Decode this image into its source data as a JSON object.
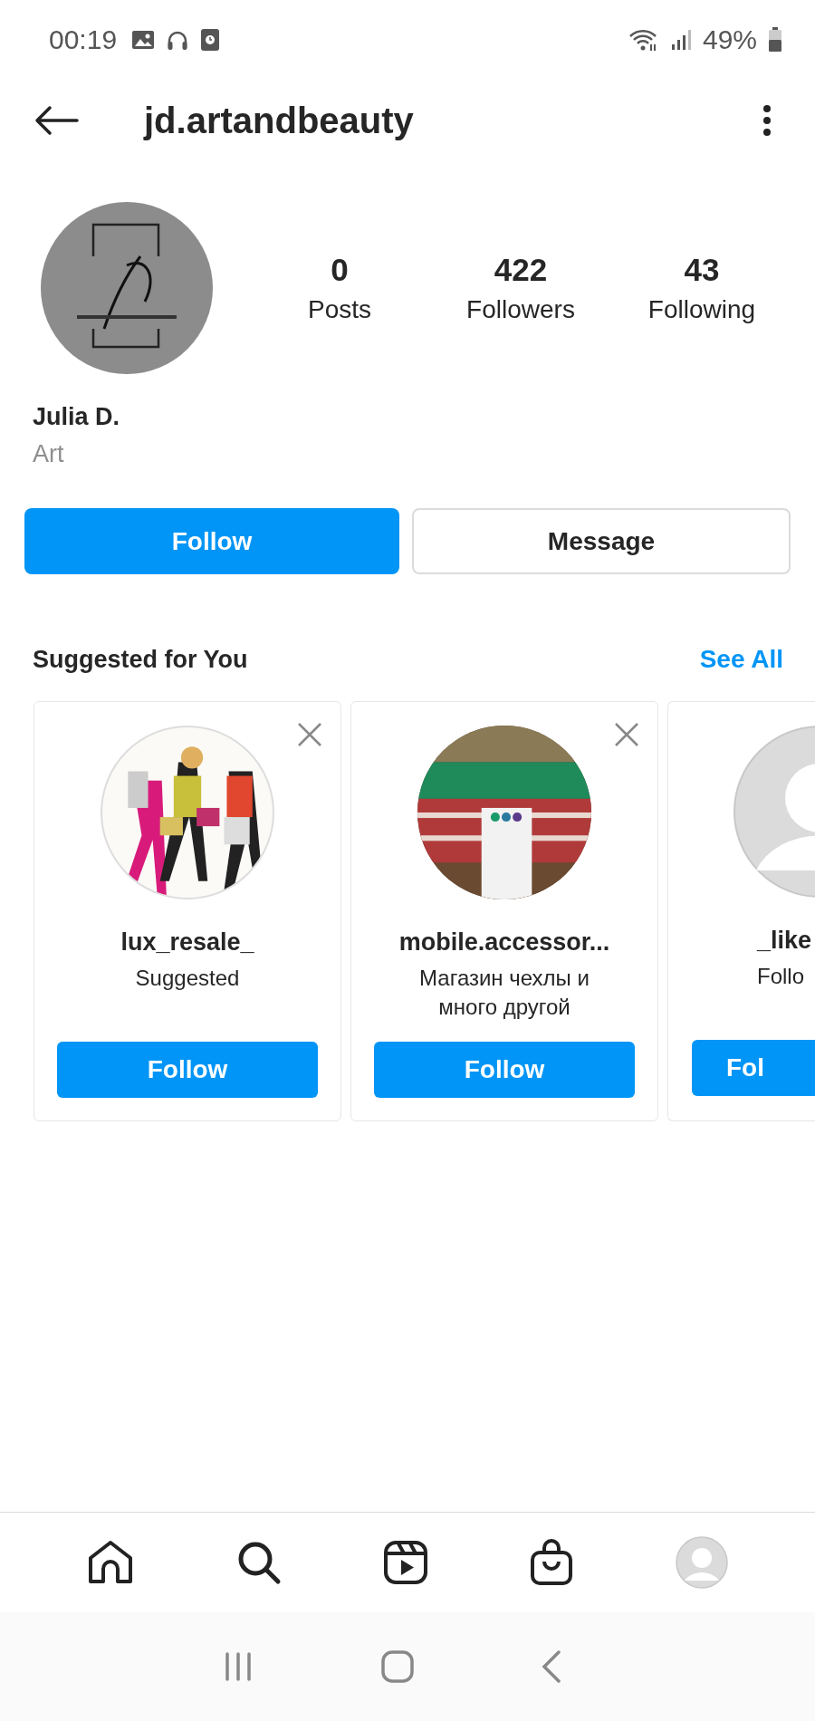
{
  "status_bar": {
    "time": "00:19",
    "battery": "49%"
  },
  "header": {
    "username": "jd.artandbeauty"
  },
  "profile": {
    "stats": [
      {
        "value": "0",
        "label": "Posts"
      },
      {
        "value": "422",
        "label": "Followers"
      },
      {
        "value": "43",
        "label": "Following"
      }
    ],
    "name": "Julia D.",
    "category": "Art"
  },
  "actions": [
    {
      "label": "Follow",
      "kind": "primary"
    },
    {
      "label": "Message",
      "kind": "secondary"
    }
  ],
  "suggested": {
    "title": "Suggested for You",
    "see_all": "See All",
    "cards": [
      {
        "kind": "full",
        "username": "lux_resale_",
        "subtitle": "Suggested",
        "button": "Follow"
      },
      {
        "kind": "full",
        "username": "mobile.accessor...",
        "subtitle": "Магазин чехлы и много другой",
        "button": "Follow"
      },
      {
        "kind": "partial",
        "username": "_like",
        "subtitle": "Follo",
        "button": "Fol"
      }
    ]
  },
  "bottom_nav": [
    {
      "kind": "home"
    },
    {
      "kind": "search"
    },
    {
      "kind": "reels"
    },
    {
      "kind": "shop"
    },
    {
      "kind": "profile"
    }
  ]
}
